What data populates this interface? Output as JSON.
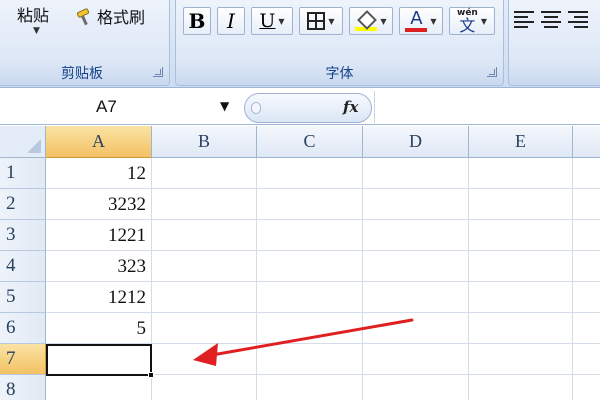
{
  "ribbon": {
    "clipboard": {
      "paste_label": "粘贴",
      "format_painter_label": "格式刷",
      "group_label": "剪贴板"
    },
    "font": {
      "bold_label": "B",
      "italic_label": "I",
      "underline_label": "U",
      "font_color_label": "A",
      "phonetic_pinyin": "wén",
      "phonetic_char": "文",
      "group_label": "字体",
      "fill_color": "#ffff00",
      "font_color": "#e02020"
    }
  },
  "formula_bar": {
    "name_box_value": "A7",
    "fx_label": "fx",
    "formula_value": ""
  },
  "sheet": {
    "columns": [
      "A",
      "B",
      "C",
      "D",
      "E"
    ],
    "active_column": "A",
    "rows": [
      "1",
      "2",
      "3",
      "4",
      "5",
      "6",
      "7",
      "8"
    ],
    "active_row": "7",
    "column_a_values": [
      "12",
      "3232",
      "1221",
      "323",
      "1212",
      "5",
      ""
    ],
    "selected_cell": "A7"
  },
  "annotation": {
    "arrow_color": "#e02020"
  }
}
